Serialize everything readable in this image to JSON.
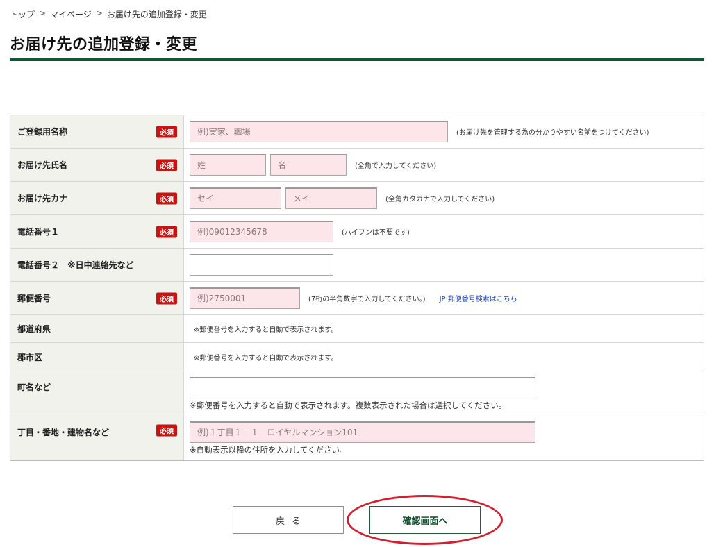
{
  "breadcrumb": {
    "items": [
      "トップ",
      "マイページ",
      "お届け先の追加登録・変更"
    ],
    "separator": ">"
  },
  "page": {
    "title": "お届け先の追加登録・変更"
  },
  "required_badge": "必須",
  "form": {
    "registration_name": {
      "label": "ご登録用名称",
      "placeholder": "例)実家、職場",
      "hint": "(お届け先を管理する為の分かりやすい名前をつけてください)"
    },
    "recipient_name": {
      "label": "お届け先氏名",
      "last_placeholder": "姓",
      "first_placeholder": "名",
      "hint": "(全角で入力してください)"
    },
    "recipient_kana": {
      "label": "お届け先カナ",
      "last_placeholder": "セイ",
      "first_placeholder": "メイ",
      "hint": "(全角カタカナで入力してください)"
    },
    "phone1": {
      "label": "電話番号１",
      "placeholder": "例)09012345678",
      "hint": "(ハイフンは不要です)"
    },
    "phone2": {
      "label": "電話番号２　※日中連絡先など",
      "value": ""
    },
    "postal_code": {
      "label": "郵便番号",
      "placeholder": "例)2750001",
      "hint": "(7桁の半角数字で入力してください。)",
      "search_link": "JP 郵便番号検索はこちら"
    },
    "prefecture": {
      "label": "都道府県",
      "note": "※郵便番号を入力すると自動で表示されます。"
    },
    "city": {
      "label": "郡市区",
      "note": "※郵便番号を入力すると自動で表示されます。"
    },
    "town": {
      "label": "町名など",
      "value": "",
      "note": "※郵便番号を入力すると自動で表示されます。複数表示された場合は選択してください。"
    },
    "address_detail": {
      "label": "丁目・番地・建物名など",
      "placeholder": "例)１丁目１－１　ロイヤルマンション101",
      "note": "※自動表示以降の住所を入力してください。"
    }
  },
  "buttons": {
    "back": "戻る",
    "confirm": "確認画面へ"
  },
  "colors": {
    "accent_green": "#0b5a32",
    "required_red": "#cc1111",
    "input_pink": "#fde6e9",
    "label_bg": "#f2f2ec",
    "annotation_red": "#d41e2e"
  }
}
